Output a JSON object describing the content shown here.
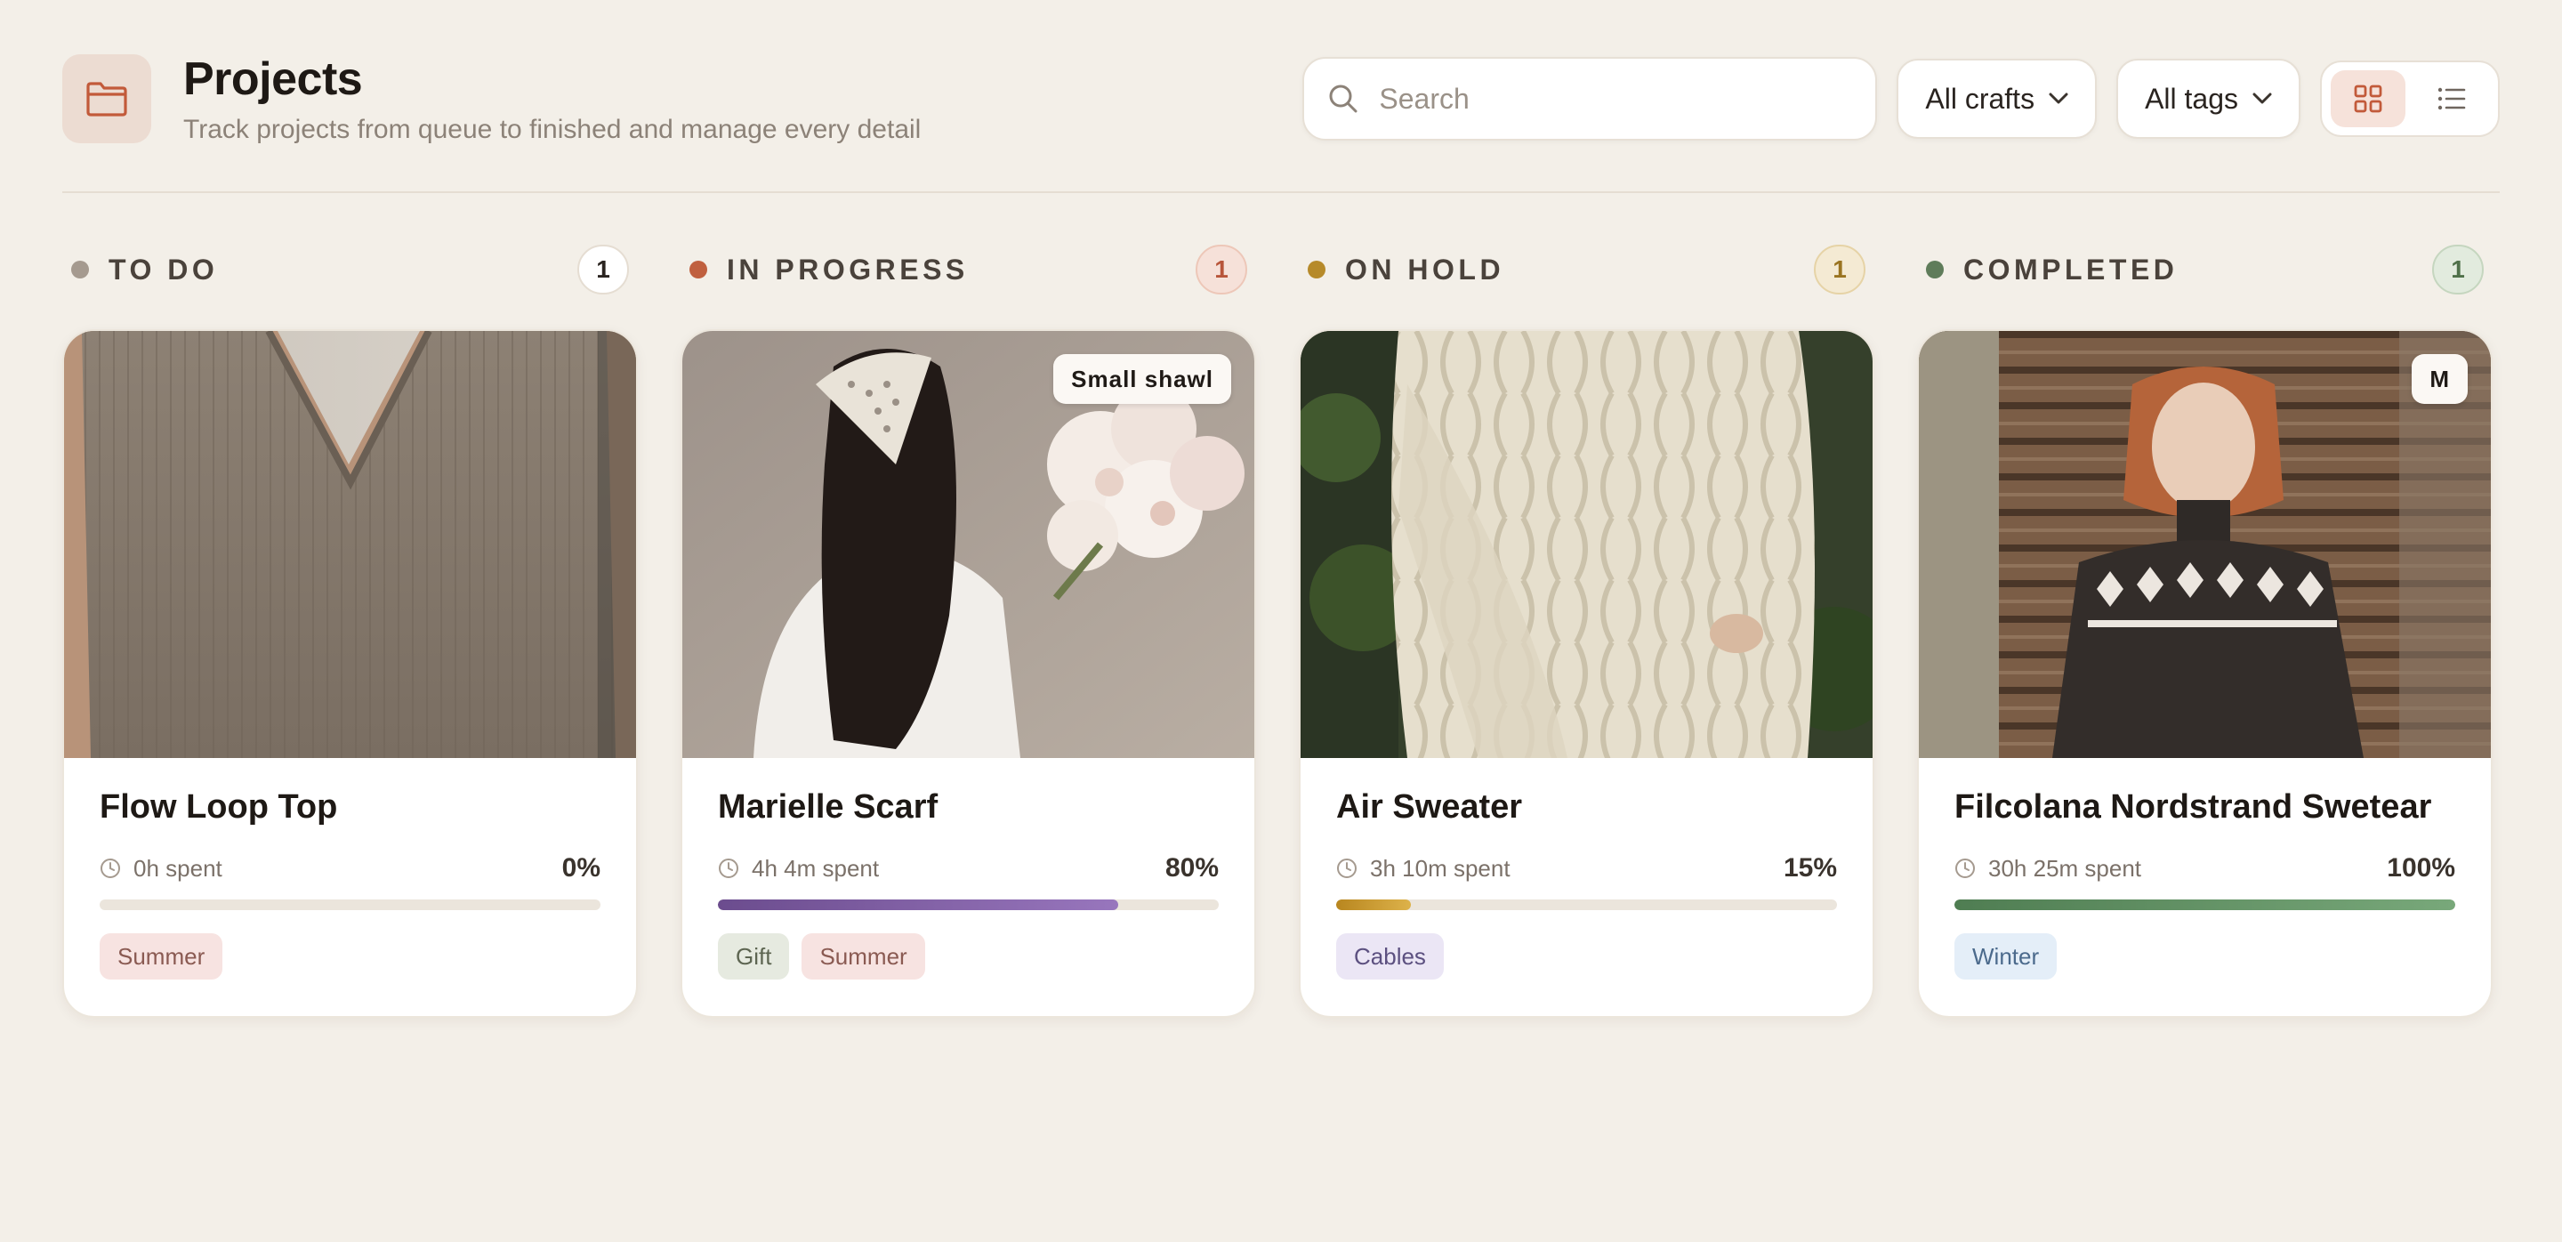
{
  "header": {
    "title": "Projects",
    "subtitle": "Track projects from queue to finished and manage every detail",
    "icon": "folder-icon"
  },
  "search": {
    "placeholder": "Search",
    "value": ""
  },
  "filters": {
    "crafts_label": "All crafts",
    "tags_label": "All tags"
  },
  "view": {
    "active": "grid",
    "options": [
      "grid-view-icon",
      "list-view-icon"
    ]
  },
  "columns": [
    {
      "title": "TO DO",
      "count": "1",
      "color": "#a59a8f",
      "card": {
        "title": "Flow Loop Top",
        "time": "0h spent",
        "percent": "0%",
        "progress": 0,
        "badge": "",
        "tags": [
          {
            "label": "Summer",
            "bg": "#f7e3e1",
            "fg": "#8a5a52"
          }
        ]
      }
    },
    {
      "title": "IN PROGRESS",
      "count": "1",
      "color": "#c0603f",
      "card": {
        "title": "Marielle Scarf",
        "time": "4h 4m spent",
        "percent": "80%",
        "progress": 0.8,
        "badge": "Small shawl",
        "tags": [
          {
            "label": "Gift",
            "bg": "#e6eae0",
            "fg": "#5d6551"
          },
          {
            "label": "Summer",
            "bg": "#f7e3e1",
            "fg": "#8a5a52"
          }
        ]
      }
    },
    {
      "title": "ON HOLD",
      "count": "1",
      "color": "#b68a2a",
      "card": {
        "title": "Air Sweater",
        "time": "3h 10m spent",
        "percent": "15%",
        "progress": 0.15,
        "badge": "",
        "tags": [
          {
            "label": "Cables",
            "bg": "#ebe6f5",
            "fg": "#5c5080"
          }
        ]
      }
    },
    {
      "title": "COMPLETED",
      "count": "1",
      "color": "#5f7c5a",
      "card": {
        "title": "Filcolana Nordstrand Swetear",
        "time": "30h 25m spent",
        "percent": "100%",
        "progress": 1,
        "badge": "M",
        "tags": [
          {
            "label": "Winter",
            "bg": "#e4eef8",
            "fg": "#4b6a8c"
          }
        ]
      }
    }
  ],
  "colors": {
    "accent": "#c25a3a",
    "progress_in_progress": "#7d5aa6",
    "progress_on_hold": "#c99a2e",
    "progress_completed": "#5d8a5e"
  }
}
